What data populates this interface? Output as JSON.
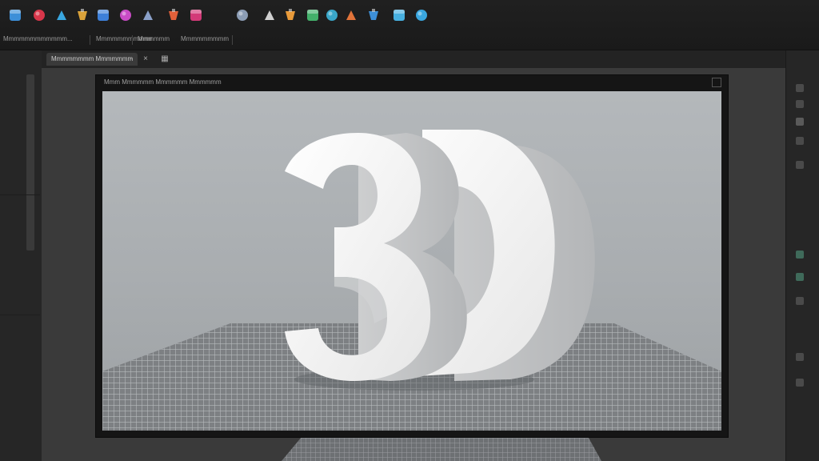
{
  "toolbar": {
    "tools": [
      {
        "name": "cube-tool-icon",
        "color": "#3d8fd8"
      },
      {
        "name": "sphere-tool-icon",
        "color": "#d8364a"
      },
      {
        "name": "paint-tool-icon",
        "color": "#3aa7e0"
      },
      {
        "name": "curve-tool-icon",
        "color": "#d9a23a"
      },
      {
        "name": "material-tool-icon",
        "color": "#3d7fd8"
      },
      {
        "name": "torus-tool-icon",
        "color": "#c94cc6"
      },
      {
        "name": "box-select-icon",
        "color": "#8aa0c8"
      },
      {
        "name": "sculpt-tool-icon",
        "color": "#e2603a"
      },
      {
        "name": "brush-tool-icon",
        "color": "#d33a78"
      },
      {
        "name": "ring-tool-icon",
        "color": "#8c9db5"
      },
      {
        "name": "knife-tool-icon",
        "color": "#cfcfcf"
      },
      {
        "name": "light-tool-icon",
        "color": "#e89a3a"
      },
      {
        "name": "pin-tool-icon",
        "color": "#43b06a"
      },
      {
        "name": "pen-tool-icon",
        "color": "#3aa7c9"
      },
      {
        "name": "sun-tool-icon",
        "color": "#e2743a"
      },
      {
        "name": "camera-tool-icon",
        "color": "#3d8fd8"
      },
      {
        "name": "figure-tool-icon",
        "color": "#47b0e0"
      },
      {
        "name": "render-tool-icon",
        "color": "#3aa7e0"
      }
    ],
    "status": [
      "Mmmmmmmmmmmm...",
      "Mmmmmmmmmmmmm",
      "Mmmmmm",
      "Mmmmmmmmmmmmmmm"
    ]
  },
  "tabs": [
    {
      "label": "Mmmmmmmm Mmmmmmm"
    }
  ],
  "viewport": {
    "title": "Mmm Mmmmmm Mmmmmm Mmmmmm",
    "object_text": "3D"
  },
  "colors": {
    "accent": "#3d8fd8",
    "scene_bg": "#b4b8bb",
    "grid": "#8e9194"
  }
}
